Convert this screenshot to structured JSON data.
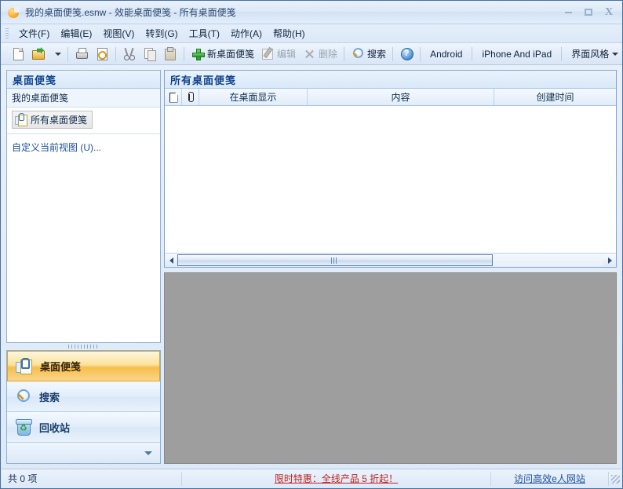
{
  "window": {
    "title": "我的桌面便笺.esnw - 效能桌面便笺 - 所有桌面便笺",
    "app_icon": "sticky-note-app-icon",
    "minimize_label": "─",
    "maximize_label": "❐",
    "close_label": "X"
  },
  "menubar": {
    "items": [
      {
        "label": "文件(F)",
        "text": "文件",
        "accel": "F"
      },
      {
        "label": "编辑(E)",
        "text": "编辑",
        "accel": "E"
      },
      {
        "label": "视图(V)",
        "text": "视图",
        "accel": "V"
      },
      {
        "label": "转到(G)",
        "text": "转到",
        "accel": "G"
      },
      {
        "label": "工具(T)",
        "text": "工具",
        "accel": "T"
      },
      {
        "label": "动作(A)",
        "text": "动作",
        "accel": "A"
      },
      {
        "label": "帮助(H)",
        "text": "帮助",
        "accel": "H"
      }
    ]
  },
  "toolbar": {
    "new_file_icon": "new-document-icon",
    "open_icon": "open-folder-icon",
    "print_icon": "printer-icon",
    "print_preview_icon": "print-preview-icon",
    "cut_icon": "scissors-icon",
    "copy_icon": "copy-icon",
    "paste_icon": "paste-icon",
    "new_note_label": "新桌面便笺",
    "edit_label": "编辑",
    "delete_label": "删除",
    "search_label": "搜索",
    "help_icon": "question-mark-icon",
    "android_label": "Android",
    "iphone_label": "iPhone And iPad",
    "skin_label": "界面风格"
  },
  "sidebar": {
    "header": "桌面便笺",
    "group_title": "我的桌面便笺",
    "tree_item": "所有桌面便笺",
    "tree_item_icon": "note-item-icon",
    "customize_link": "自定义当前视图 (U)...",
    "nav_buttons": [
      {
        "label": "桌面便笺",
        "icon": "note-nav-icon",
        "selected": true
      },
      {
        "label": "搜索",
        "icon": "magnifier-nav-icon",
        "selected": false
      },
      {
        "label": "回收站",
        "icon": "recycle-bin-nav-icon",
        "selected": false
      }
    ],
    "more_icon": "chevron-down-icon"
  },
  "list": {
    "header": "所有桌面便笺",
    "columns": [
      {
        "key": "doc",
        "label": "",
        "icon": "document-column-icon"
      },
      {
        "key": "clip",
        "label": "",
        "icon": "paperclip-column-icon"
      },
      {
        "key": "show",
        "label": "在桌面显示"
      },
      {
        "key": "content",
        "label": "内容"
      },
      {
        "key": "time",
        "label": "创建时间"
      }
    ],
    "rows": [],
    "scroll": {
      "left_arrow_icon": "scroll-left-arrow-icon",
      "right_arrow_icon": "scroll-right-arrow-icon",
      "thumb_position_percent": 0,
      "thumb_width_percent": 74
    }
  },
  "preview": {
    "background_color": "#9e9e9e"
  },
  "statusbar": {
    "count_text": "共 0 项",
    "promo_text": "限时特惠：全线产品 5 折起！",
    "promo_color": "#c0241f",
    "site_text": "访问高效e人网站",
    "site_color": "#1b4f9c",
    "resize_grip_icon": "resize-grip-icon"
  }
}
